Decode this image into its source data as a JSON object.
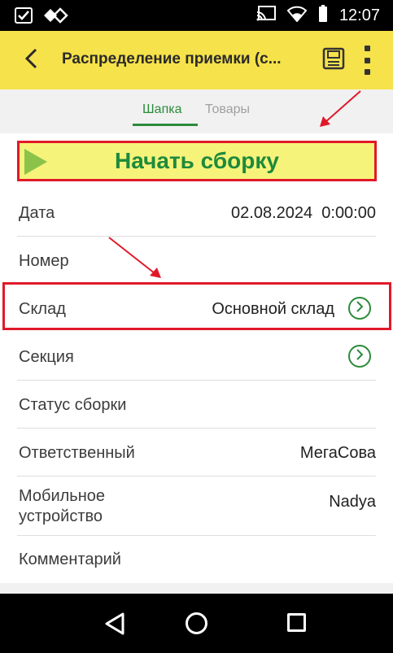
{
  "status_bar": {
    "time": "12:07",
    "left_icons": [
      "check-box-icon",
      "diamond-link-icon"
    ],
    "right_icons": [
      "cast-icon",
      "wifi-icon",
      "battery-icon"
    ]
  },
  "app_bar": {
    "title": "Распределение приемки (с...",
    "icons": [
      "back-arrow-icon",
      "save-floppy-icon",
      "more-vert-icon"
    ],
    "color": "#f6e24a"
  },
  "tabs": [
    {
      "label": "Шапка",
      "active": true
    },
    {
      "label": "Товары",
      "active": false
    }
  ],
  "start_button": {
    "label": "Начать сборку",
    "icon": "play-triangle-icon",
    "highlighted": true
  },
  "fields": {
    "date": {
      "label": "Дата",
      "value": "02.08.2024  0:00:00"
    },
    "number": {
      "label": "Номер",
      "value": ""
    },
    "warehouse": {
      "label": "Склад",
      "value": "Основной склад",
      "highlighted": true
    },
    "section": {
      "label": "Секция",
      "value": ""
    },
    "assembly_status": {
      "label": "Статус сборки",
      "value": ""
    },
    "responsible": {
      "label": "Ответственный",
      "value": "МегаСова"
    },
    "mobile_device": {
      "label_line1": "Мобильное",
      "label_line2": "устройство",
      "value": "Nadya"
    },
    "comment": {
      "label": "Комментарий",
      "value": ""
    }
  },
  "nav_bar": {
    "icons": [
      "nav-back-icon",
      "nav-home-icon",
      "nav-recent-icon"
    ]
  },
  "colors": {
    "accent_green": "#2b8b3a",
    "highlight_red": "#e0192a",
    "button_yellow": "#f6f37a"
  }
}
